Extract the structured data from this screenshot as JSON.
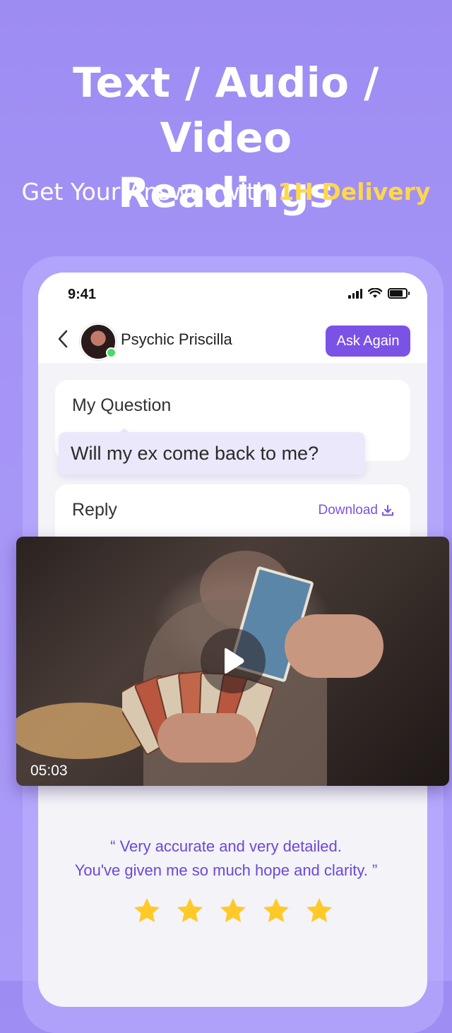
{
  "hero": {
    "title_line1": "Text / Audio / Video",
    "title_line2": "Readings",
    "subtitle_prefix": "Get Your Answer with ",
    "subtitle_highlight": "1H Delivery"
  },
  "status_bar": {
    "time": "9:41"
  },
  "header": {
    "back_icon": "chevron-left-icon",
    "psychic_name": "Psychic Priscilla",
    "ask_again_label": "Ask Again"
  },
  "question": {
    "title": "My Question",
    "text": "Will my ex come back to me?"
  },
  "reply": {
    "title": "Reply",
    "download_label": "Download",
    "download_icon": "download-icon"
  },
  "video": {
    "duration": "05:03",
    "play_icon": "play-icon"
  },
  "review": {
    "line1": "“ Very accurate and very detailed.",
    "line2": "You've given me so much hope and clarity. ”",
    "rating": 5
  },
  "colors": {
    "background": "#a594f6",
    "accent": "#7b52e6",
    "highlight": "#ffd84a",
    "star": "#ffc928"
  }
}
